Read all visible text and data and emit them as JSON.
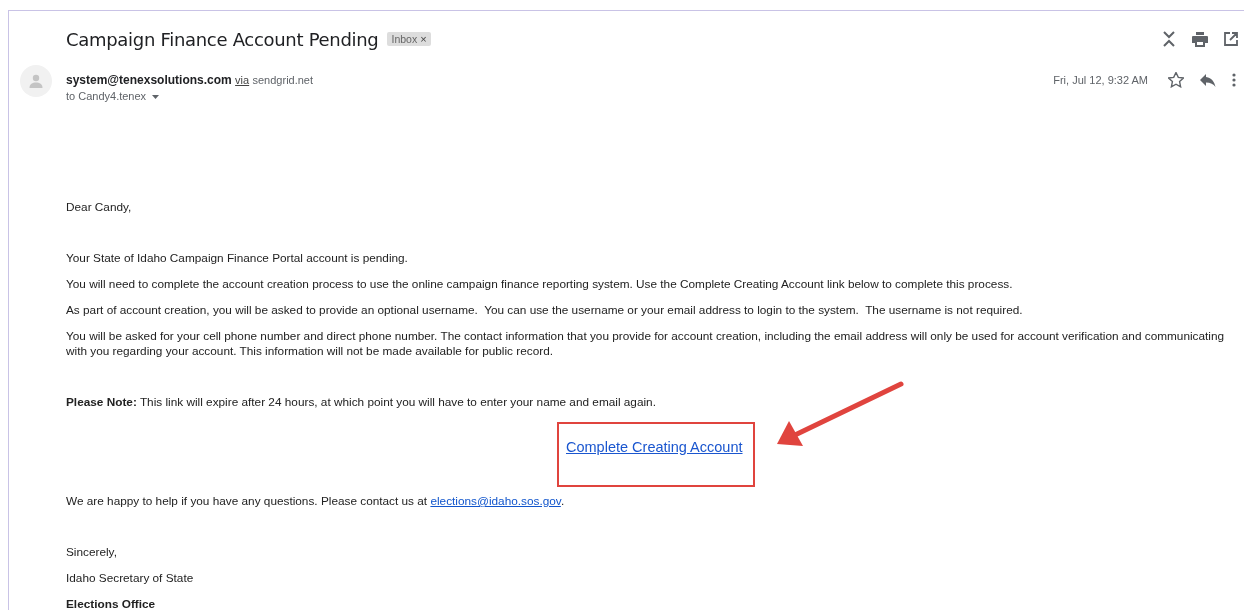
{
  "subject": {
    "title": "Campaign Finance Account Pending",
    "label": "Inbox",
    "label_remove": "×"
  },
  "sender": {
    "email": "system@tenexsolutions.com",
    "via": "via",
    "domain": "sendgrid.net",
    "recipient": "to Candy4.tenex",
    "date": "Fri, Jul 12, 9:32 AM",
    "starred": false
  },
  "body": {
    "greeting": "Dear Candy,",
    "paragraphs": [
      "Your State of Idaho Campaign Finance Portal account is pending.",
      "You will need to complete the account creation process to use the online campaign finance reporting system. Use the Complete Creating Account link below to complete this process.",
      "As part of account creation, you will be asked to provide an optional username.  You can use the username or your email address to login to the system.  The username is not required.",
      "You will be asked for your cell phone number and direct phone number. The contact information that you provide for account creation, including the email address will only be used for account verification and communicating with you regarding your account. This information will not be made available for public record."
    ],
    "note": "**Please Note:** This link will expire after 24 hours, at which point you will have to enter your name and email again.",
    "action_link": "Complete Creating Account",
    "help": {
      "text": "We are happy to help if you have any questions. Please contact us at ",
      "email": "elections@idaho.sos.gov",
      "end": "."
    },
    "closing": "Sincerely,",
    "signature": "Idaho Secretary of State",
    "office": "Elections Office"
  }
}
